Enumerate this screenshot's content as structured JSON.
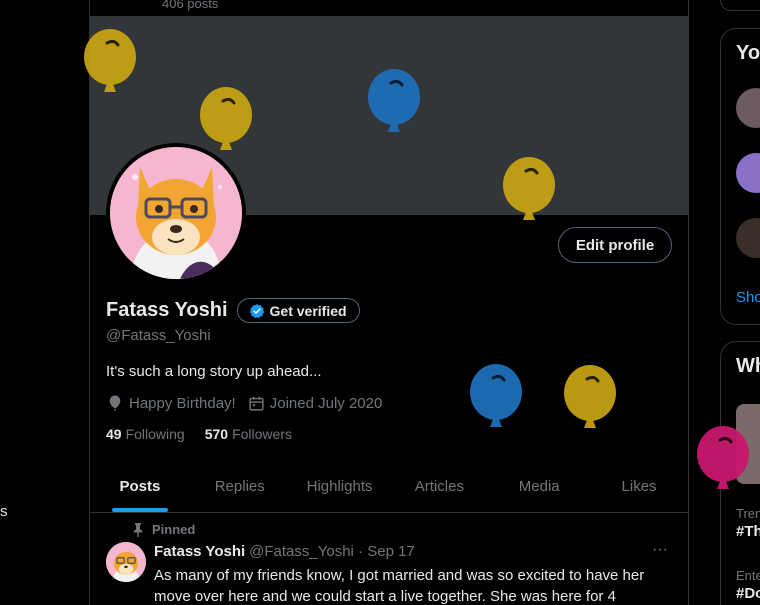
{
  "header": {
    "post_count": "406 posts"
  },
  "left_edge_glyph": "s",
  "profile": {
    "display_name": "Fatass Yoshi",
    "verified_label": "Get verified",
    "handle": "@Fatass_Yoshi",
    "bio": "It's such a long story up ahead...",
    "birthday": "Happy Birthday!",
    "joined": "Joined July 2020",
    "following_count": "49",
    "following_label": "Following",
    "followers_count": "570",
    "followers_label": "Followers",
    "edit_label": "Edit profile"
  },
  "tabs": [
    {
      "label": "Posts",
      "active": true
    },
    {
      "label": "Replies",
      "active": false
    },
    {
      "label": "Highlights",
      "active": false
    },
    {
      "label": "Articles",
      "active": false
    },
    {
      "label": "Media",
      "active": false
    },
    {
      "label": "Likes",
      "active": false
    }
  ],
  "pinned_tweet": {
    "pinned_label": "Pinned",
    "name": "Fatass Yoshi",
    "handle_date": "@Fatass_Yoshi · Sep 17",
    "more": "···",
    "text": "As many of my friends know, I got married and was so excited to have her move over here and we could start a live together. She was here for 4"
  },
  "right_sidebar": {
    "panel1_title": "Yo",
    "show_more": "Sho",
    "panel2_title": "Wh",
    "trend1_label": "Tren",
    "trend1_tag": "#Th",
    "trend2_label": "Ente",
    "trend2_tag": "#Do"
  },
  "colors": {
    "accent": "#1d9bf0",
    "balloon_gold": "#c9a514",
    "balloon_blue": "#1d6fb8",
    "balloon_pink": "#c8176e",
    "banner": "#333639"
  },
  "icons": [
    "verified-badge-icon",
    "balloon-icon",
    "calendar-icon",
    "pin-icon",
    "more-icon"
  ]
}
